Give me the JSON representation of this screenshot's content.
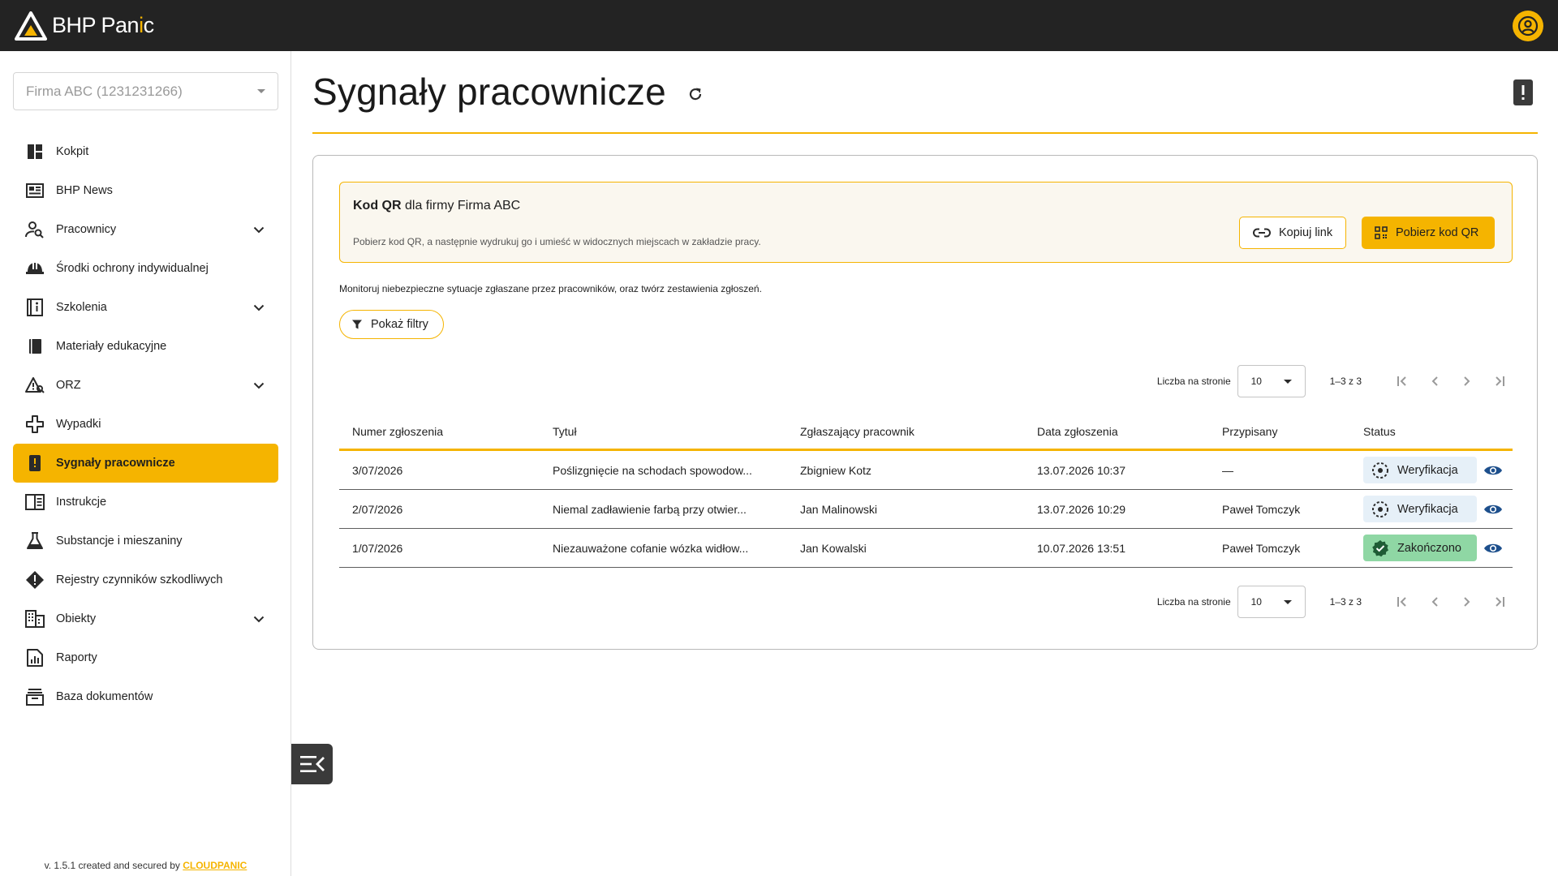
{
  "app": {
    "logo_text_1": "BHP Pan",
    "logo_text_accent": "i",
    "logo_text_2": "c"
  },
  "sidebar": {
    "company_select": "Firma ABC (1231231266)",
    "items": [
      {
        "label": "Kokpit",
        "icon": "dashboard-icon"
      },
      {
        "label": "BHP News",
        "icon": "news-icon"
      },
      {
        "label": "Pracownicy",
        "icon": "person-search-icon",
        "expandable": true
      },
      {
        "label": "Środki ochrony indywidualnej",
        "icon": "hard-hat-icon"
      },
      {
        "label": "Szkolenia",
        "icon": "training-book-icon",
        "expandable": true
      },
      {
        "label": "Materiały edukacyjne",
        "icon": "book-icon"
      },
      {
        "label": "ORZ",
        "icon": "risk-warning-icon",
        "expandable": true
      },
      {
        "label": "Wypadki",
        "icon": "medical-icon"
      },
      {
        "label": "Sygnały pracownicze",
        "icon": "alert-phone-icon",
        "active": true
      },
      {
        "label": "Instrukcje",
        "icon": "instructions-icon"
      },
      {
        "label": "Substancje i mieszaniny",
        "icon": "flask-icon"
      },
      {
        "label": "Rejestry czynników szkodliwych",
        "icon": "warning-diamond-icon"
      },
      {
        "label": "Obiekty",
        "icon": "building-icon",
        "expandable": true
      },
      {
        "label": "Raporty",
        "icon": "report-icon"
      },
      {
        "label": "Baza dokumentów",
        "icon": "archive-icon"
      }
    ],
    "footer_version": "v. 1.5.1 created and secured by ",
    "footer_brand": "CLOUDPANIC"
  },
  "page": {
    "title": "Sygnały pracownicze"
  },
  "qr": {
    "title_bold": "Kod QR",
    "title_rest": " dla firmy Firma ABC",
    "description": "Pobierz kod QR, a następnie wydrukuj go i umieść w widocznych miejscach w zakładzie pracy.",
    "copy_link_label": "Kopiuj link",
    "download_label": "Pobierz kod QR"
  },
  "info_text": "Monitoruj niebezpieczne sytuacje zgłaszane przez pracowników, oraz twórz zestawienia zgłoszeń.",
  "filters_label": "Pokaż filtry",
  "pagination": {
    "per_page_label": "Liczba na stronie",
    "per_page_value": "10",
    "range": "1–3 z 3"
  },
  "table": {
    "headers": [
      "Numer zgłoszenia",
      "Tytuł",
      "Zgłaszający pracownik",
      "Data zgłoszenia",
      "Przypisany",
      "Status"
    ],
    "rows": [
      {
        "number": "3/07/2026",
        "title": "Poślizgnięcie na schodach spowodow...",
        "reporter": "Zbigniew Kotz",
        "date": "13.07.2026 10:37",
        "assigned": "—",
        "status": "Weryfikacja"
      },
      {
        "number": "2/07/2026",
        "title": "Niemal zadławienie farbą przy otwier...",
        "reporter": "Jan Malinowski",
        "date": "13.07.2026 10:29",
        "assigned": "Paweł Tomczyk",
        "status": "Weryfikacja"
      },
      {
        "number": "1/07/2026",
        "title": "Niezauważone cofanie wózka widłow...",
        "reporter": "Jan Kowalski",
        "date": "10.07.2026 13:51",
        "assigned": "Paweł Tomczyk",
        "status": "Zakończono"
      }
    ]
  },
  "colors": {
    "accent": "#f5b400",
    "topbar": "#232323",
    "status_verify_bg": "#e6f0f8",
    "status_done_bg": "#8fd7a4",
    "eye": "#1d4f8c"
  }
}
